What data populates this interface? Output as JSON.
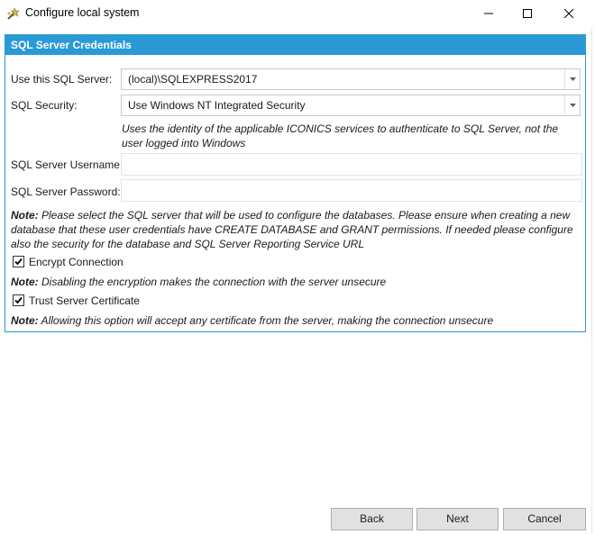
{
  "window": {
    "title": "Configure local system"
  },
  "panel": {
    "title": "SQL Server Credentials"
  },
  "fields": {
    "sql_server_label": "Use this SQL Server:",
    "sql_server_value": "(local)\\SQLEXPRESS2017",
    "sql_security_label": "SQL Security:",
    "sql_security_value": "Use Windows NT Integrated Security",
    "security_hint": "Uses the identity of the applicable ICONICS services to authenticate to SQL Server, not the user logged into Windows",
    "username_label": "SQL Server Username:",
    "username_value": "",
    "password_label": "SQL Server Password:",
    "password_value": ""
  },
  "notes": {
    "prefix": "Note:",
    "main": " Please select the SQL server that will be used to configure the databases. Please ensure when creating a new database that these user credentials have CREATE DATABASE and GRANT permissions. If needed please configure also the security for the database and SQL Server Reporting Service URL",
    "encryption": " Disabling the encryption makes the connection with the server unsecure",
    "trust": " Allowing this option will accept any certificate from the server, making the connection unsecure"
  },
  "checkboxes": {
    "encrypt_label": "Encrypt Connection",
    "encrypt_checked": true,
    "trust_label": "Trust Server Certificate",
    "trust_checked": true
  },
  "buttons": {
    "back": "Back",
    "next": "Next",
    "cancel": "Cancel"
  },
  "icons": {
    "app": "wizard-icon",
    "minimize": "minimize-icon",
    "maximize": "maximize-icon",
    "close": "close-icon",
    "dropdown": "chevron-down-icon",
    "check": "checkmark-icon"
  },
  "colors": {
    "accent": "#2a9ad6",
    "button_face": "#e1e1e1"
  }
}
